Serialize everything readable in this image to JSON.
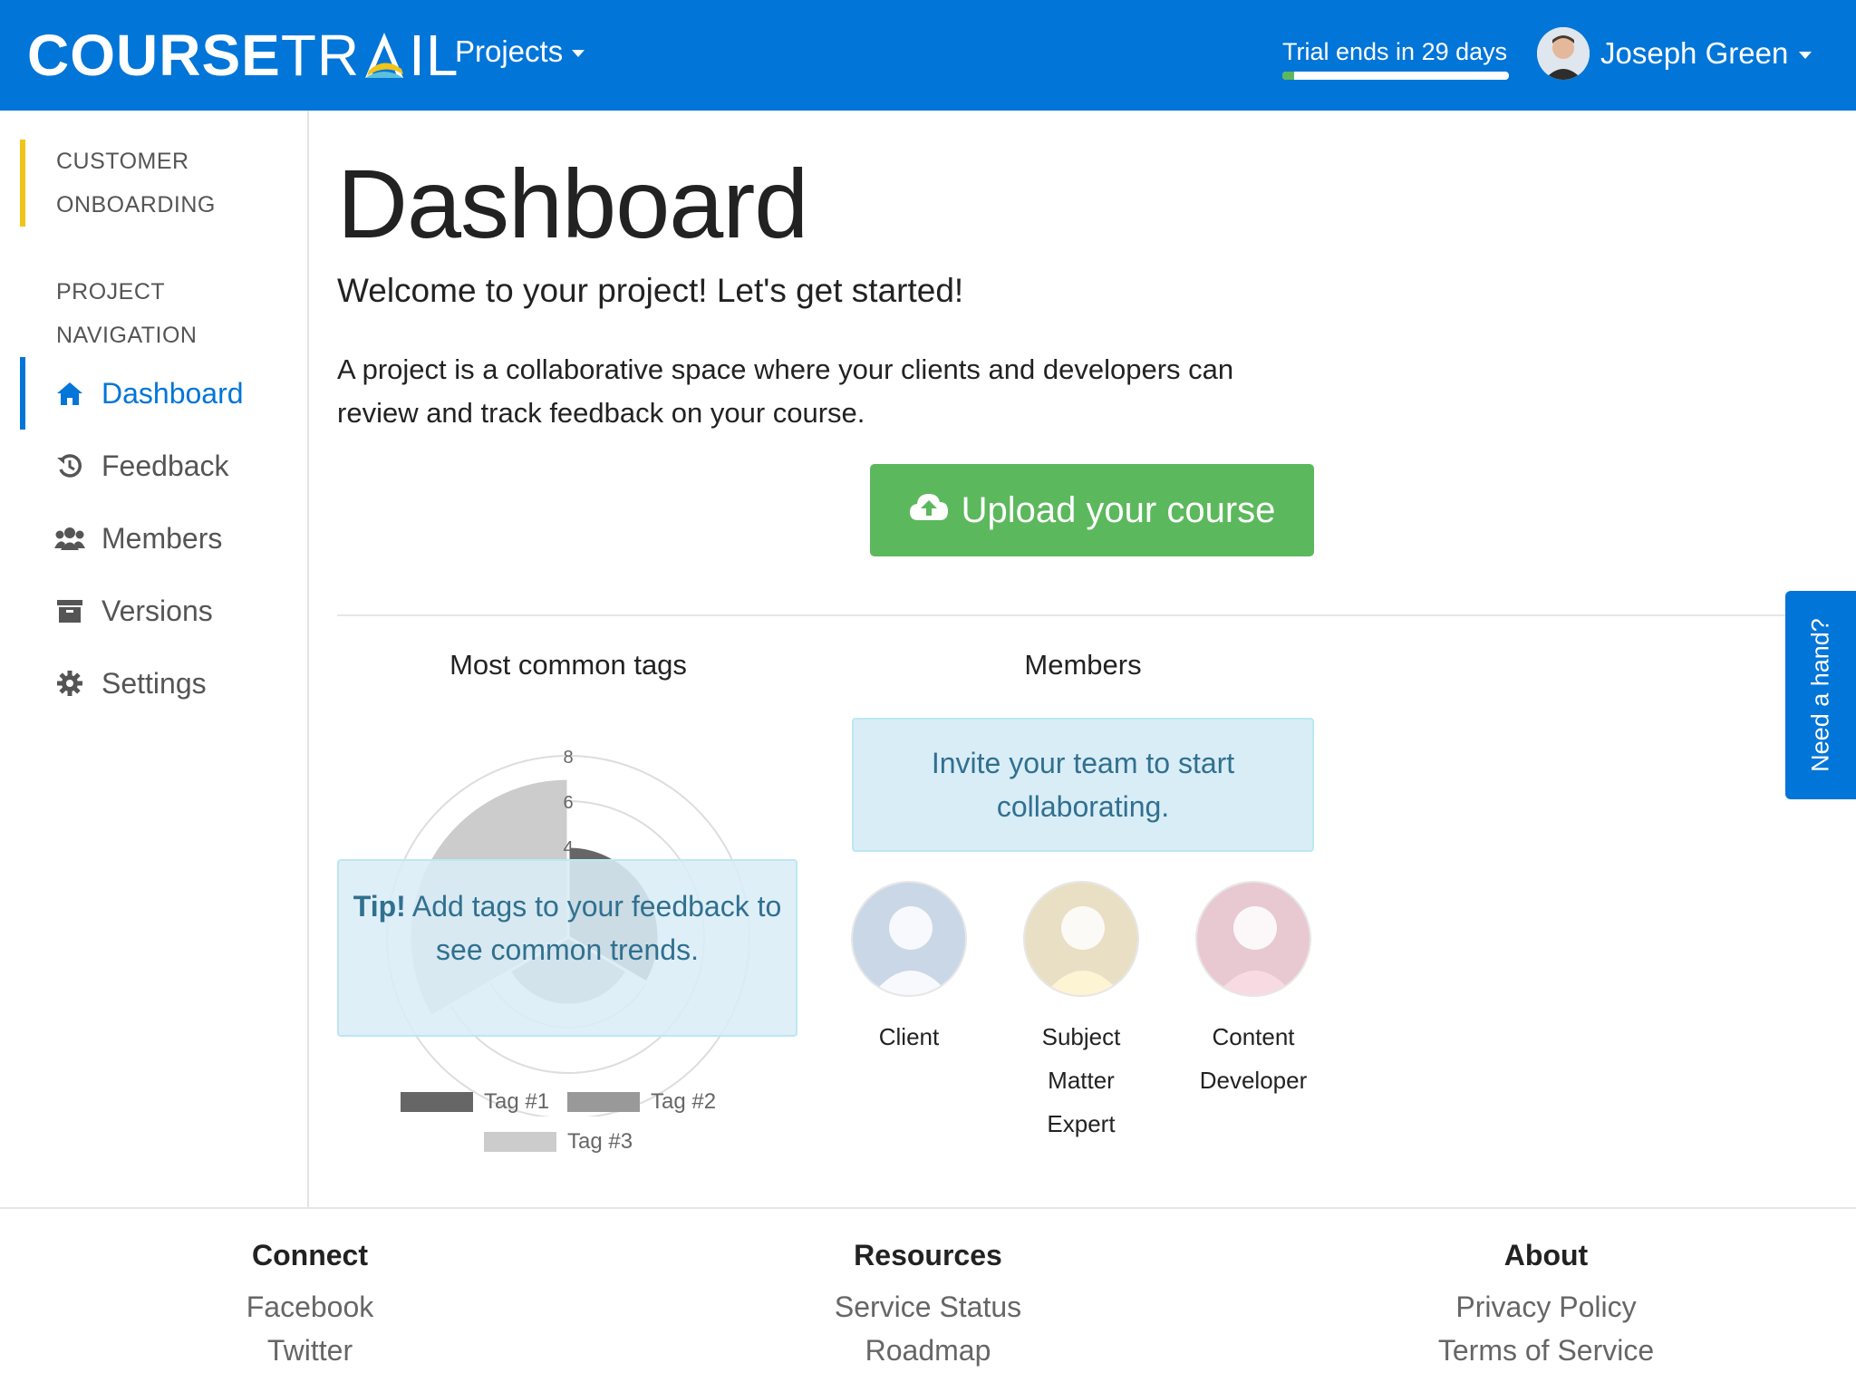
{
  "navbar": {
    "logo_bold": "COURSE",
    "logo_light": "TR",
    "logo_light_end": "IL",
    "projects_label": "Projects",
    "trial_text": "Trial ends in 29 days",
    "trial_progress_percent": 5,
    "user_name": "Joseph Green"
  },
  "sidebar": {
    "section_onboarding": [
      "CUSTOMER",
      "ONBOARDING"
    ],
    "section_navigation": [
      "PROJECT",
      "NAVIGATION"
    ],
    "items": [
      {
        "label": "Dashboard",
        "icon": "home-icon",
        "active": true
      },
      {
        "label": "Feedback",
        "icon": "history-icon",
        "active": false
      },
      {
        "label": "Members",
        "icon": "users-icon",
        "active": false
      },
      {
        "label": "Versions",
        "icon": "archive-icon",
        "active": false
      },
      {
        "label": "Settings",
        "icon": "gear-icon",
        "active": false
      }
    ]
  },
  "main": {
    "title": "Dashboard",
    "welcome": "Welcome to your project! Let's get started!",
    "description": "A project is a collaborative space where your clients and developers can review and track feedback on your course.",
    "upload_label": "Upload your course",
    "tags_title": "Most common tags",
    "tip_bold": "Tip!",
    "tip_text": "Add tags to your feedback to see common trends.",
    "members_title": "Members",
    "invite_text": "Invite your team to start collaborating.",
    "members": [
      {
        "label": "Client",
        "color": "#c9d7e6"
      },
      {
        "label": "Subject Matter Expert",
        "color": "#e8dfc4"
      },
      {
        "label": "Content Developer",
        "color": "#e8c8d1"
      }
    ]
  },
  "chart_data": {
    "type": "polar-area",
    "categories": [
      "Tag #1",
      "Tag #2",
      "Tag #3"
    ],
    "values": [
      4,
      3,
      7
    ],
    "colors": [
      "#666666",
      "#999999",
      "#cccccc"
    ],
    "rlim": [
      0,
      8
    ],
    "ticks": [
      "4",
      "6",
      "8"
    ],
    "grid": true,
    "legend": "bottom"
  },
  "need_hand": "Need a hand?",
  "footer": {
    "columns": [
      {
        "heading": "Connect",
        "links": [
          "Facebook",
          "Twitter"
        ]
      },
      {
        "heading": "Resources",
        "links": [
          "Service Status",
          "Roadmap"
        ]
      },
      {
        "heading": "About",
        "links": [
          "Privacy Policy",
          "Terms of Service"
        ]
      }
    ]
  }
}
